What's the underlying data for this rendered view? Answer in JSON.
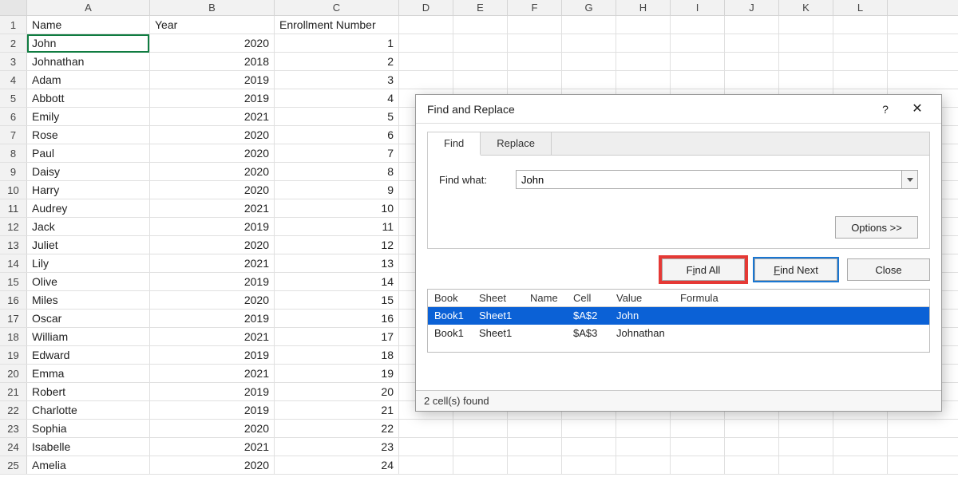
{
  "columns": [
    "A",
    "B",
    "C",
    "D",
    "E",
    "F",
    "G",
    "H",
    "I",
    "J",
    "K",
    "L"
  ],
  "col_widths": {
    "A": 154,
    "B": 156,
    "C": 156,
    "D": 68,
    "E": 68,
    "F": 68,
    "G": 68,
    "H": 68,
    "I": 68,
    "J": 68,
    "K": 68,
    "L": 68
  },
  "header_row": {
    "A": "Name",
    "B": "Year",
    "C": "Enrollment Number"
  },
  "data_rows": [
    {
      "A": "John",
      "B": "2020",
      "C": "1"
    },
    {
      "A": "Johnathan",
      "B": "2018",
      "C": "2"
    },
    {
      "A": "Adam",
      "B": "2019",
      "C": "3"
    },
    {
      "A": "Abbott",
      "B": "2019",
      "C": "4"
    },
    {
      "A": "Emily",
      "B": "2021",
      "C": "5"
    },
    {
      "A": "Rose",
      "B": "2020",
      "C": "6"
    },
    {
      "A": "Paul",
      "B": "2020",
      "C": "7"
    },
    {
      "A": "Daisy",
      "B": "2020",
      "C": "8"
    },
    {
      "A": "Harry",
      "B": "2020",
      "C": "9"
    },
    {
      "A": "Audrey",
      "B": "2021",
      "C": "10"
    },
    {
      "A": "Jack",
      "B": "2019",
      "C": "11"
    },
    {
      "A": "Juliet",
      "B": "2020",
      "C": "12"
    },
    {
      "A": "Lily",
      "B": "2021",
      "C": "13"
    },
    {
      "A": "Olive",
      "B": "2019",
      "C": "14"
    },
    {
      "A": "Miles",
      "B": "2020",
      "C": "15"
    },
    {
      "A": "Oscar",
      "B": "2019",
      "C": "16"
    },
    {
      "A": "William",
      "B": "2021",
      "C": "17"
    },
    {
      "A": "Edward",
      "B": "2019",
      "C": "18"
    },
    {
      "A": "Emma",
      "B": "2021",
      "C": "19"
    },
    {
      "A": "Robert",
      "B": "2019",
      "C": "20"
    },
    {
      "A": "Charlotte",
      "B": "2019",
      "C": "21"
    },
    {
      "A": "Sophia",
      "B": "2020",
      "C": "22"
    },
    {
      "A": "Isabelle",
      "B": "2021",
      "C": "23"
    },
    {
      "A": "Amelia",
      "B": "2020",
      "C": "24"
    }
  ],
  "selected_cell": "A2",
  "dialog": {
    "title": "Find and Replace",
    "help_symbol": "?",
    "close_symbol": "✕",
    "tabs": [
      {
        "key": "find",
        "label": "Find",
        "active": true
      },
      {
        "key": "replace",
        "label": "Replace",
        "active": false
      }
    ],
    "find_label": "Find what:",
    "find_value": "John",
    "options_label": "Options >>",
    "findall_label_pre": "F",
    "findall_label_accel": "i",
    "findall_label_post": "nd All",
    "findnext_label_pre": "",
    "findnext_label_accel": "F",
    "findnext_label_post": "ind Next",
    "close_label": "Close",
    "result_headers": [
      "Book",
      "Sheet",
      "Name",
      "Cell",
      "Value",
      "Formula"
    ],
    "results": [
      {
        "book": "Book1",
        "sheet": "Sheet1",
        "name": "",
        "cell": "$A$2",
        "value": "John",
        "formula": "",
        "selected": true
      },
      {
        "book": "Book1",
        "sheet": "Sheet1",
        "name": "",
        "cell": "$A$3",
        "value": "Johnathan",
        "formula": "",
        "selected": false
      }
    ],
    "status": "2 cell(s) found"
  }
}
